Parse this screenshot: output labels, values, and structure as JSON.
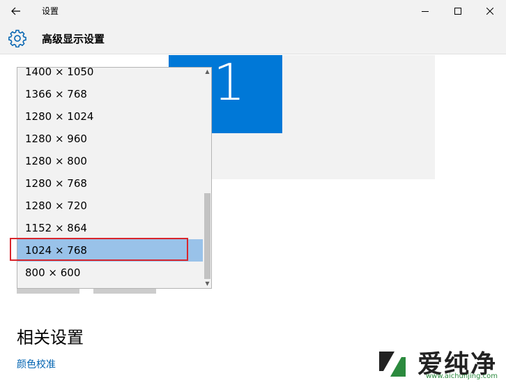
{
  "window": {
    "title": "设置",
    "back_icon": "arrow-left-icon",
    "minimize_icon": "minimize-icon",
    "maximize_icon": "maximize-icon",
    "close_icon": "close-icon"
  },
  "header": {
    "icon": "gear-icon",
    "title": "高级显示设置"
  },
  "preview": {
    "monitor_number": "1",
    "accent_color": "#0078d7"
  },
  "resolution_dropdown": {
    "items": [
      {
        "label": "1400 × 1050"
      },
      {
        "label": "1366 × 768"
      },
      {
        "label": "1280 × 1024"
      },
      {
        "label": "1280 × 960"
      },
      {
        "label": "1280 × 800"
      },
      {
        "label": "1280 × 768"
      },
      {
        "label": "1280 × 720"
      },
      {
        "label": "1152 × 864"
      },
      {
        "label": "1024 × 768"
      },
      {
        "label": "800 × 600"
      }
    ],
    "selected": "1024 × 768",
    "selection_color": "#99c2e9",
    "highlight_color": "#d9262c"
  },
  "related": {
    "title": "相关设置",
    "link": "颜色校准",
    "link_color": "#0063b1"
  },
  "watermark": {
    "text": "爱纯净",
    "url": "www.aichunjing.com"
  }
}
